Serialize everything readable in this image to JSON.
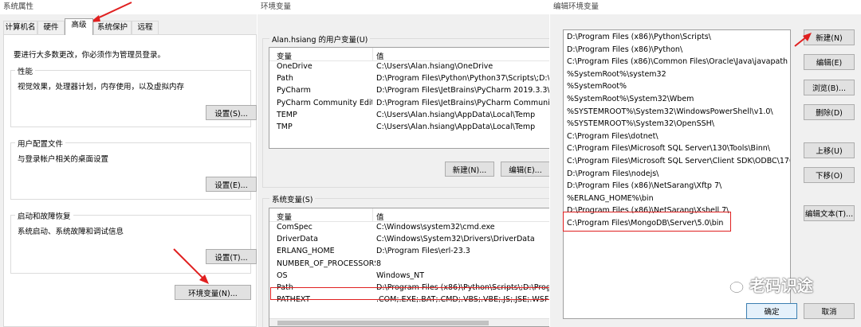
{
  "sysprops": {
    "title": "系统属性",
    "tabs": [
      "计算机名",
      "硬件",
      "高级",
      "系统保护",
      "远程"
    ],
    "admin_note": "要进行大多数更改，你必须作为管理员登录。",
    "performance": {
      "title": "性能",
      "desc": "视觉效果，处理器计划，内存使用，以及虚拟内存",
      "button": "设置(S)..."
    },
    "profile": {
      "title": "用户配置文件",
      "desc": "与登录帐户相关的桌面设置",
      "button": "设置(E)..."
    },
    "startup": {
      "title": "启动和故障恢复",
      "desc": "系统启动、系统故障和调试信息",
      "button": "设置(T)..."
    },
    "env_button": "环境变量(N)..."
  },
  "envvars": {
    "title": "环境变量",
    "user_group": "Alan.hsiang 的用户变量(U)",
    "system_group": "系统变量(S)",
    "col_var": "变量",
    "col_val": "值",
    "user_vars": [
      {
        "name": "OneDrive",
        "value": "C:\\Users\\Alan.hsiang\\OneDrive"
      },
      {
        "name": "Path",
        "value": "D:\\Program Files\\Python\\Python37\\Scripts\\;D:\\Prog"
      },
      {
        "name": "PyCharm",
        "value": "D:\\Program Files\\JetBrains\\PyCharm 2019.3.3\\bin;"
      },
      {
        "name": "PyCharm Community Editi...",
        "value": "D:\\Program Files\\JetBrains\\PyCharm Community Ec"
      },
      {
        "name": "TEMP",
        "value": "C:\\Users\\Alan.hsiang\\AppData\\Local\\Temp"
      },
      {
        "name": "TMP",
        "value": "C:\\Users\\Alan.hsiang\\AppData\\Local\\Temp"
      }
    ],
    "system_vars": [
      {
        "name": "ComSpec",
        "value": "C:\\Windows\\system32\\cmd.exe"
      },
      {
        "name": "DriverData",
        "value": "C:\\Windows\\System32\\Drivers\\DriverData"
      },
      {
        "name": "ERLANG_HOME",
        "value": "D:\\Program Files\\erl-23.3"
      },
      {
        "name": "NUMBER_OF_PROCESSORS",
        "value": "8"
      },
      {
        "name": "OS",
        "value": "Windows_NT"
      },
      {
        "name": "Path",
        "value": "D:\\Program Files (x86)\\Python\\Scripts\\;D:\\Program"
      },
      {
        "name": "PATHEXT",
        "value": ".COM;.EXE;.BAT;.CMD;.VBS;.VBE;.JS;.JSE;.WSF;.WSH;"
      }
    ],
    "new_button": "新建(N)...",
    "edit_button": "编辑(E)..."
  },
  "editenv": {
    "title": "编辑环境变量",
    "paths": [
      "D:\\Program Files (x86)\\Python\\Scripts\\",
      "D:\\Program Files (x86)\\Python\\",
      "C:\\Program Files (x86)\\Common Files\\Oracle\\Java\\javapath",
      "%SystemRoot%\\system32",
      "%SystemRoot%",
      "%SystemRoot%\\System32\\Wbem",
      "%SYSTEMROOT%\\System32\\WindowsPowerShell\\v1.0\\",
      "%SYSTEMROOT%\\System32\\OpenSSH\\",
      "C:\\Program Files\\dotnet\\",
      "C:\\Program Files\\Microsoft SQL Server\\130\\Tools\\Binn\\",
      "C:\\Program Files\\Microsoft SQL Server\\Client SDK\\ODBC\\170\\T",
      "D:\\Program Files\\nodejs\\",
      "D:\\Program Files (x86)\\NetSarang\\Xftp 7\\",
      "%ERLANG_HOME%\\bin",
      "D:\\Program Files (x86)\\NetSarang\\Xshell 7\\",
      "C:\\Program Files\\MongoDB\\Server\\5.0\\bin"
    ],
    "buttons": {
      "new": "新建(N)",
      "edit": "编辑(E)",
      "browse": "浏览(B)...",
      "delete": "删除(D)",
      "up": "上移(U)",
      "down": "下移(O)",
      "edit_text": "编辑文本(T)..."
    },
    "ok": "确定",
    "cancel": "取消"
  },
  "watermark": "老码识途",
  "colors": {
    "annotation": "#e02020",
    "selection": "#cce8ff",
    "dialog_bg": "#f0f0f0"
  }
}
